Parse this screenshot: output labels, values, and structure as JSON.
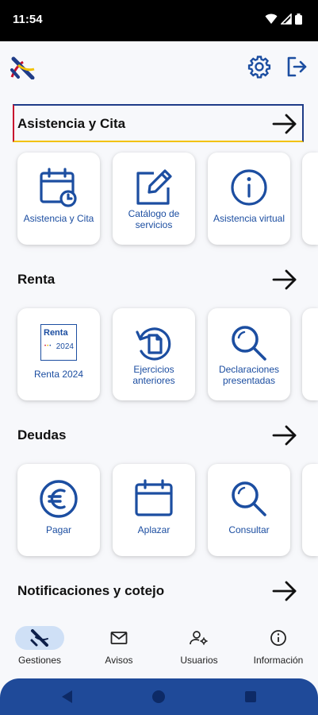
{
  "status": {
    "time": "11:54"
  },
  "sections": {
    "asistencia": {
      "title": "Asistencia y Cita",
      "cards": [
        {
          "label": "Asistencia y Cita",
          "icon": "calendar-clock-icon"
        },
        {
          "label": "Catálogo de servicios",
          "icon": "edit-square-icon"
        },
        {
          "label": "Asistencia virtual",
          "icon": "info-circle-icon"
        }
      ]
    },
    "renta": {
      "title": "Renta",
      "cards": [
        {
          "label": "Renta 2024",
          "icon": "renta-2024-logo",
          "logo_line1": "Renta",
          "logo_line2": "2024"
        },
        {
          "label": "Ejercicios anteriores",
          "icon": "history-document-icon"
        },
        {
          "label": "Declaraciones presentadas",
          "icon": "search-icon"
        }
      ]
    },
    "deudas": {
      "title": "Deudas",
      "cards": [
        {
          "label": "Pagar",
          "icon": "euro-icon"
        },
        {
          "label": "Aplazar",
          "icon": "calendar-icon"
        },
        {
          "label": "Consultar",
          "icon": "search-icon"
        }
      ]
    },
    "notificaciones": {
      "title": "Notificaciones y cotejo"
    }
  },
  "bottom_nav": [
    {
      "label": "Gestiones",
      "icon": "agencia-logo-icon",
      "active": true
    },
    {
      "label": "Avisos",
      "icon": "mail-icon",
      "active": false
    },
    {
      "label": "Usuarios",
      "icon": "users-settings-icon",
      "active": false
    },
    {
      "label": "Información",
      "icon": "info-icon",
      "active": false
    }
  ],
  "colors": {
    "primary": "#1c4ea1",
    "accent_red": "#c8102e",
    "accent_yellow": "#f2c200",
    "nav_active_bg": "#cfe0f6"
  }
}
